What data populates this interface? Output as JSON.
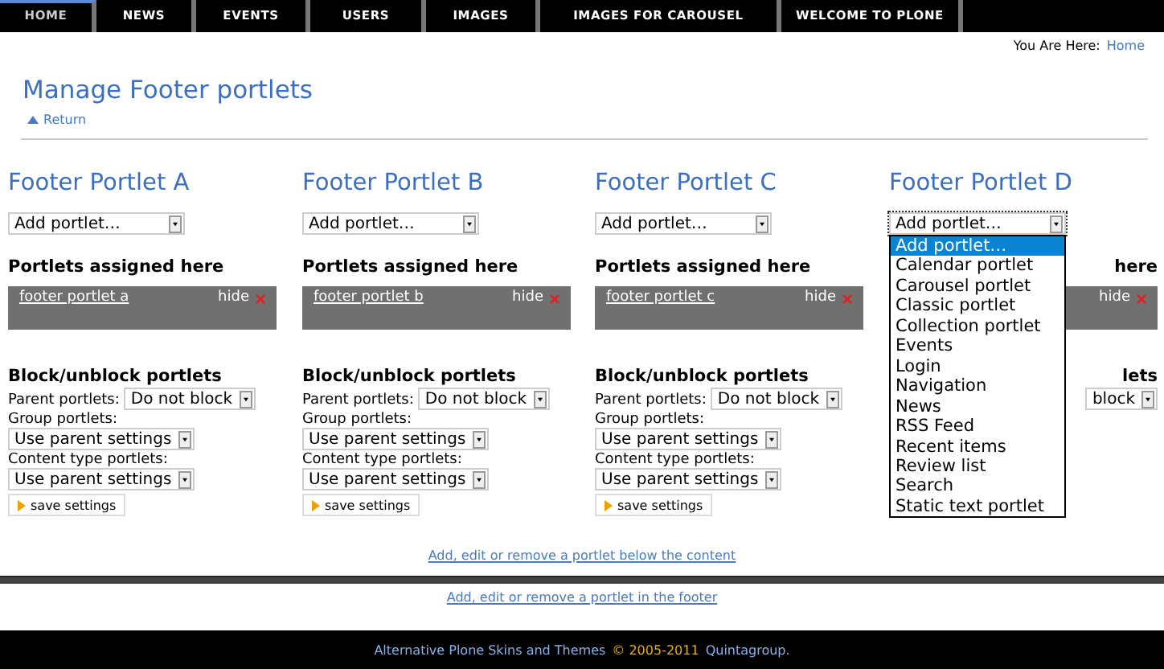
{
  "nav": [
    {
      "label": "HOME",
      "selected": true
    },
    {
      "label": "NEWS",
      "selected": false
    },
    {
      "label": "EVENTS",
      "selected": false
    },
    {
      "label": "USERS",
      "selected": false
    },
    {
      "label": "IMAGES",
      "selected": false
    },
    {
      "label": "IMAGES FOR CAROUSEL",
      "selected": false
    },
    {
      "label": "WELCOME TO PLONE",
      "selected": false
    }
  ],
  "breadcrumb": {
    "label": "You Are Here:",
    "link": "Home"
  },
  "title": "Manage Footer portlets",
  "return_link": "Return",
  "columns": [
    {
      "kind": "full",
      "heading": "Footer Portlet A",
      "add_select": "Add portlet…",
      "assigned_heading": "Portlets assigned here",
      "portlet": "footer portlet a",
      "hide": "hide",
      "block_heading": "Block/unblock portlets",
      "parent_label": "Parent portlets:",
      "parent_value": "Do not block",
      "group_label": "Group portlets:",
      "group_value": "Use parent settings",
      "content_label": "Content type portlets:",
      "content_value": "Use parent settings",
      "save": "save settings"
    },
    {
      "kind": "full",
      "heading": "Footer Portlet B",
      "add_select": "Add portlet…",
      "assigned_heading": "Portlets assigned here",
      "portlet": "footer portlet b",
      "hide": "hide",
      "block_heading": "Block/unblock portlets",
      "parent_label": "Parent portlets:",
      "parent_value": "Do not block",
      "group_label": "Group portlets:",
      "group_value": "Use parent settings",
      "content_label": "Content type portlets:",
      "content_value": "Use parent settings",
      "save": "save settings"
    },
    {
      "kind": "full",
      "heading": "Footer Portlet C",
      "add_select": "Add portlet…",
      "assigned_heading": "Portlets assigned here",
      "portlet": "footer portlet c",
      "hide": "hide",
      "block_heading": "Block/unblock portlets",
      "parent_label": "Parent portlets:",
      "parent_value": "Do not block",
      "group_label": "Group portlets:",
      "group_value": "Use parent settings",
      "content_label": "Content type portlets:",
      "content_value": "Use parent settings",
      "save": "save settings"
    },
    {
      "kind": "covered",
      "heading": "Footer Portlet D",
      "add_select": "Add portlet…",
      "assigned_heading": "here",
      "hide": "hide",
      "block_heading": "lets",
      "parent_value": "block",
      "dropdown": [
        {
          "label": "Add portlet…",
          "selected": true
        },
        {
          "label": "Calendar portlet",
          "selected": false
        },
        {
          "label": "Carousel portlet",
          "selected": false
        },
        {
          "label": "Classic portlet",
          "selected": false
        },
        {
          "label": "Collection portlet",
          "selected": false
        },
        {
          "label": "Events",
          "selected": false
        },
        {
          "label": "Login",
          "selected": false
        },
        {
          "label": "Navigation",
          "selected": false
        },
        {
          "label": "News",
          "selected": false
        },
        {
          "label": "RSS Feed",
          "selected": false
        },
        {
          "label": "Recent items",
          "selected": false
        },
        {
          "label": "Review list",
          "selected": false
        },
        {
          "label": "Search",
          "selected": false
        },
        {
          "label": "Static text portlet",
          "selected": false
        }
      ]
    }
  ],
  "below_link": "Add, edit or remove a portlet below the content",
  "footer_link": "Add, edit or remove a portlet in the footer",
  "footer": {
    "text": "Alternative Plone Skins and Themes",
    "copyright": "© 2005-2011",
    "company": "Quintagroup."
  }
}
